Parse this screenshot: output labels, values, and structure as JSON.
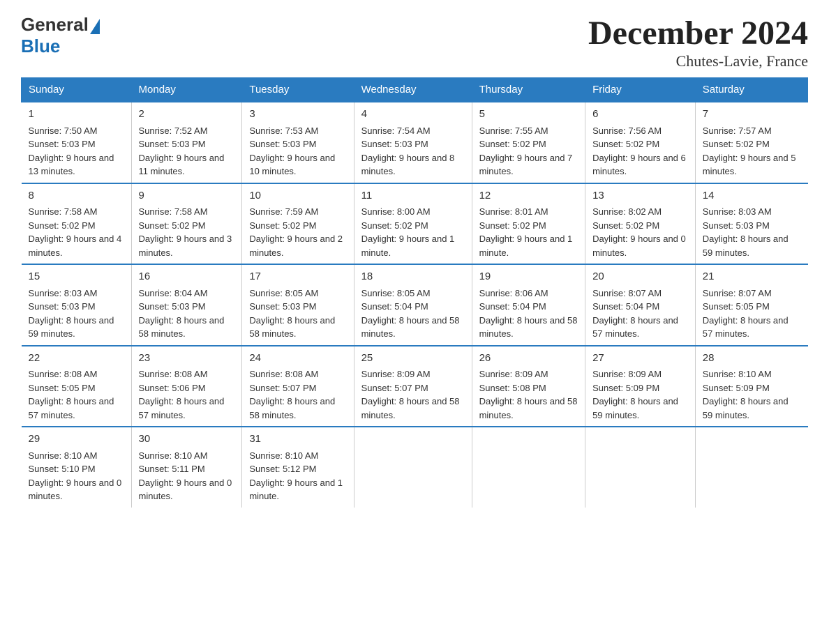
{
  "logo": {
    "general": "General",
    "blue": "Blue"
  },
  "title": "December 2024",
  "subtitle": "Chutes-Lavie, France",
  "days_of_week": [
    "Sunday",
    "Monday",
    "Tuesday",
    "Wednesday",
    "Thursday",
    "Friday",
    "Saturday"
  ],
  "weeks": [
    [
      {
        "day": "1",
        "sunrise": "7:50 AM",
        "sunset": "5:03 PM",
        "daylight": "9 hours and 13 minutes."
      },
      {
        "day": "2",
        "sunrise": "7:52 AM",
        "sunset": "5:03 PM",
        "daylight": "9 hours and 11 minutes."
      },
      {
        "day": "3",
        "sunrise": "7:53 AM",
        "sunset": "5:03 PM",
        "daylight": "9 hours and 10 minutes."
      },
      {
        "day": "4",
        "sunrise": "7:54 AM",
        "sunset": "5:03 PM",
        "daylight": "9 hours and 8 minutes."
      },
      {
        "day": "5",
        "sunrise": "7:55 AM",
        "sunset": "5:02 PM",
        "daylight": "9 hours and 7 minutes."
      },
      {
        "day": "6",
        "sunrise": "7:56 AM",
        "sunset": "5:02 PM",
        "daylight": "9 hours and 6 minutes."
      },
      {
        "day": "7",
        "sunrise": "7:57 AM",
        "sunset": "5:02 PM",
        "daylight": "9 hours and 5 minutes."
      }
    ],
    [
      {
        "day": "8",
        "sunrise": "7:58 AM",
        "sunset": "5:02 PM",
        "daylight": "9 hours and 4 minutes."
      },
      {
        "day": "9",
        "sunrise": "7:58 AM",
        "sunset": "5:02 PM",
        "daylight": "9 hours and 3 minutes."
      },
      {
        "day": "10",
        "sunrise": "7:59 AM",
        "sunset": "5:02 PM",
        "daylight": "9 hours and 2 minutes."
      },
      {
        "day": "11",
        "sunrise": "8:00 AM",
        "sunset": "5:02 PM",
        "daylight": "9 hours and 1 minute."
      },
      {
        "day": "12",
        "sunrise": "8:01 AM",
        "sunset": "5:02 PM",
        "daylight": "9 hours and 1 minute."
      },
      {
        "day": "13",
        "sunrise": "8:02 AM",
        "sunset": "5:02 PM",
        "daylight": "9 hours and 0 minutes."
      },
      {
        "day": "14",
        "sunrise": "8:03 AM",
        "sunset": "5:03 PM",
        "daylight": "8 hours and 59 minutes."
      }
    ],
    [
      {
        "day": "15",
        "sunrise": "8:03 AM",
        "sunset": "5:03 PM",
        "daylight": "8 hours and 59 minutes."
      },
      {
        "day": "16",
        "sunrise": "8:04 AM",
        "sunset": "5:03 PM",
        "daylight": "8 hours and 58 minutes."
      },
      {
        "day": "17",
        "sunrise": "8:05 AM",
        "sunset": "5:03 PM",
        "daylight": "8 hours and 58 minutes."
      },
      {
        "day": "18",
        "sunrise": "8:05 AM",
        "sunset": "5:04 PM",
        "daylight": "8 hours and 58 minutes."
      },
      {
        "day": "19",
        "sunrise": "8:06 AM",
        "sunset": "5:04 PM",
        "daylight": "8 hours and 58 minutes."
      },
      {
        "day": "20",
        "sunrise": "8:07 AM",
        "sunset": "5:04 PM",
        "daylight": "8 hours and 57 minutes."
      },
      {
        "day": "21",
        "sunrise": "8:07 AM",
        "sunset": "5:05 PM",
        "daylight": "8 hours and 57 minutes."
      }
    ],
    [
      {
        "day": "22",
        "sunrise": "8:08 AM",
        "sunset": "5:05 PM",
        "daylight": "8 hours and 57 minutes."
      },
      {
        "day": "23",
        "sunrise": "8:08 AM",
        "sunset": "5:06 PM",
        "daylight": "8 hours and 57 minutes."
      },
      {
        "day": "24",
        "sunrise": "8:08 AM",
        "sunset": "5:07 PM",
        "daylight": "8 hours and 58 minutes."
      },
      {
        "day": "25",
        "sunrise": "8:09 AM",
        "sunset": "5:07 PM",
        "daylight": "8 hours and 58 minutes."
      },
      {
        "day": "26",
        "sunrise": "8:09 AM",
        "sunset": "5:08 PM",
        "daylight": "8 hours and 58 minutes."
      },
      {
        "day": "27",
        "sunrise": "8:09 AM",
        "sunset": "5:09 PM",
        "daylight": "8 hours and 59 minutes."
      },
      {
        "day": "28",
        "sunrise": "8:10 AM",
        "sunset": "5:09 PM",
        "daylight": "8 hours and 59 minutes."
      }
    ],
    [
      {
        "day": "29",
        "sunrise": "8:10 AM",
        "sunset": "5:10 PM",
        "daylight": "9 hours and 0 minutes."
      },
      {
        "day": "30",
        "sunrise": "8:10 AM",
        "sunset": "5:11 PM",
        "daylight": "9 hours and 0 minutes."
      },
      {
        "day": "31",
        "sunrise": "8:10 AM",
        "sunset": "5:12 PM",
        "daylight": "9 hours and 1 minute."
      },
      null,
      null,
      null,
      null
    ]
  ]
}
